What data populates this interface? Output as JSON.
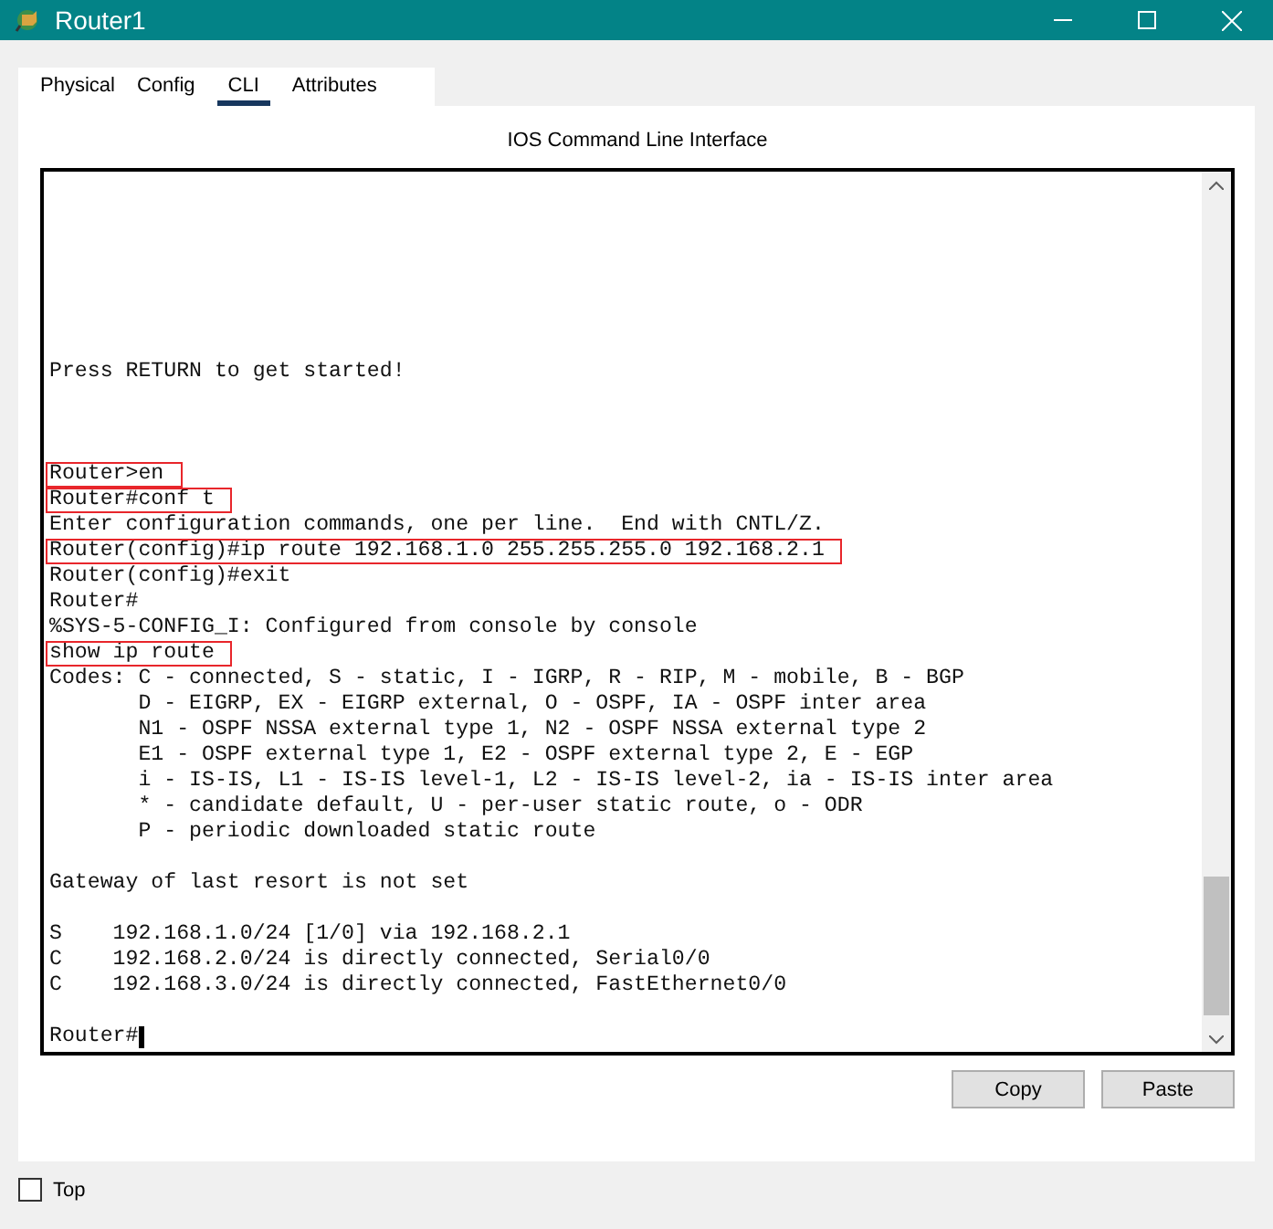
{
  "window": {
    "title": "Router1"
  },
  "tabs": [
    {
      "label": "Physical",
      "selected": false
    },
    {
      "label": "Config",
      "selected": false
    },
    {
      "label": "CLI",
      "selected": true
    },
    {
      "label": "Attributes",
      "selected": false
    }
  ],
  "panel_title": "IOS Command Line Interface",
  "terminal": {
    "blocks": [
      {
        "lines": [
          {
            "text": "Press RETURN to get started!",
            "highlighted": false
          }
        ]
      },
      {
        "lines": [
          {
            "text": "Router>en",
            "highlighted": true
          },
          {
            "text": "Router#conf t",
            "highlighted": true
          },
          {
            "text": "Enter configuration commands, one per line.  End with CNTL/Z.",
            "highlighted": false
          },
          {
            "text": "Router(config)#ip route 192.168.1.0 255.255.255.0 192.168.2.1",
            "highlighted": true
          },
          {
            "text": "Router(config)#exit",
            "highlighted": false
          },
          {
            "text": "Router#",
            "highlighted": false
          },
          {
            "text": "%SYS-5-CONFIG_I: Configured from console by console",
            "highlighted": false
          },
          {
            "text": "show ip route",
            "highlighted": true
          },
          {
            "text": "Codes: C - connected, S - static, I - IGRP, R - RIP, M - mobile, B - BGP",
            "highlighted": false
          },
          {
            "text": "       D - EIGRP, EX - EIGRP external, O - OSPF, IA - OSPF inter area",
            "highlighted": false
          },
          {
            "text": "       N1 - OSPF NSSA external type 1, N2 - OSPF NSSA external type 2",
            "highlighted": false
          },
          {
            "text": "       E1 - OSPF external type 1, E2 - OSPF external type 2, E - EGP",
            "highlighted": false
          },
          {
            "text": "       i - IS-IS, L1 - IS-IS level-1, L2 - IS-IS level-2, ia - IS-IS inter area",
            "highlighted": false
          },
          {
            "text": "       * - candidate default, U - per-user static route, o - ODR",
            "highlighted": false
          },
          {
            "text": "       P - periodic downloaded static route",
            "highlighted": false
          }
        ]
      },
      {
        "lines": [
          {
            "text": "Gateway of last resort is not set",
            "highlighted": false
          }
        ]
      },
      {
        "lines": [
          {
            "text": "S    192.168.1.0/24 [1/0] via 192.168.2.1",
            "highlighted": false
          },
          {
            "text": "C    192.168.2.0/24 is directly connected, Serial0/0",
            "highlighted": false
          },
          {
            "text": "C    192.168.3.0/24 is directly connected, FastEthernet0/0",
            "highlighted": false
          }
        ]
      },
      {
        "lines": [
          {
            "text": "Router#",
            "highlighted": false
          }
        ]
      }
    ]
  },
  "buttons": [
    "Copy",
    "Paste"
  ],
  "top_checkbox": {
    "label": "Top",
    "checked": false
  }
}
